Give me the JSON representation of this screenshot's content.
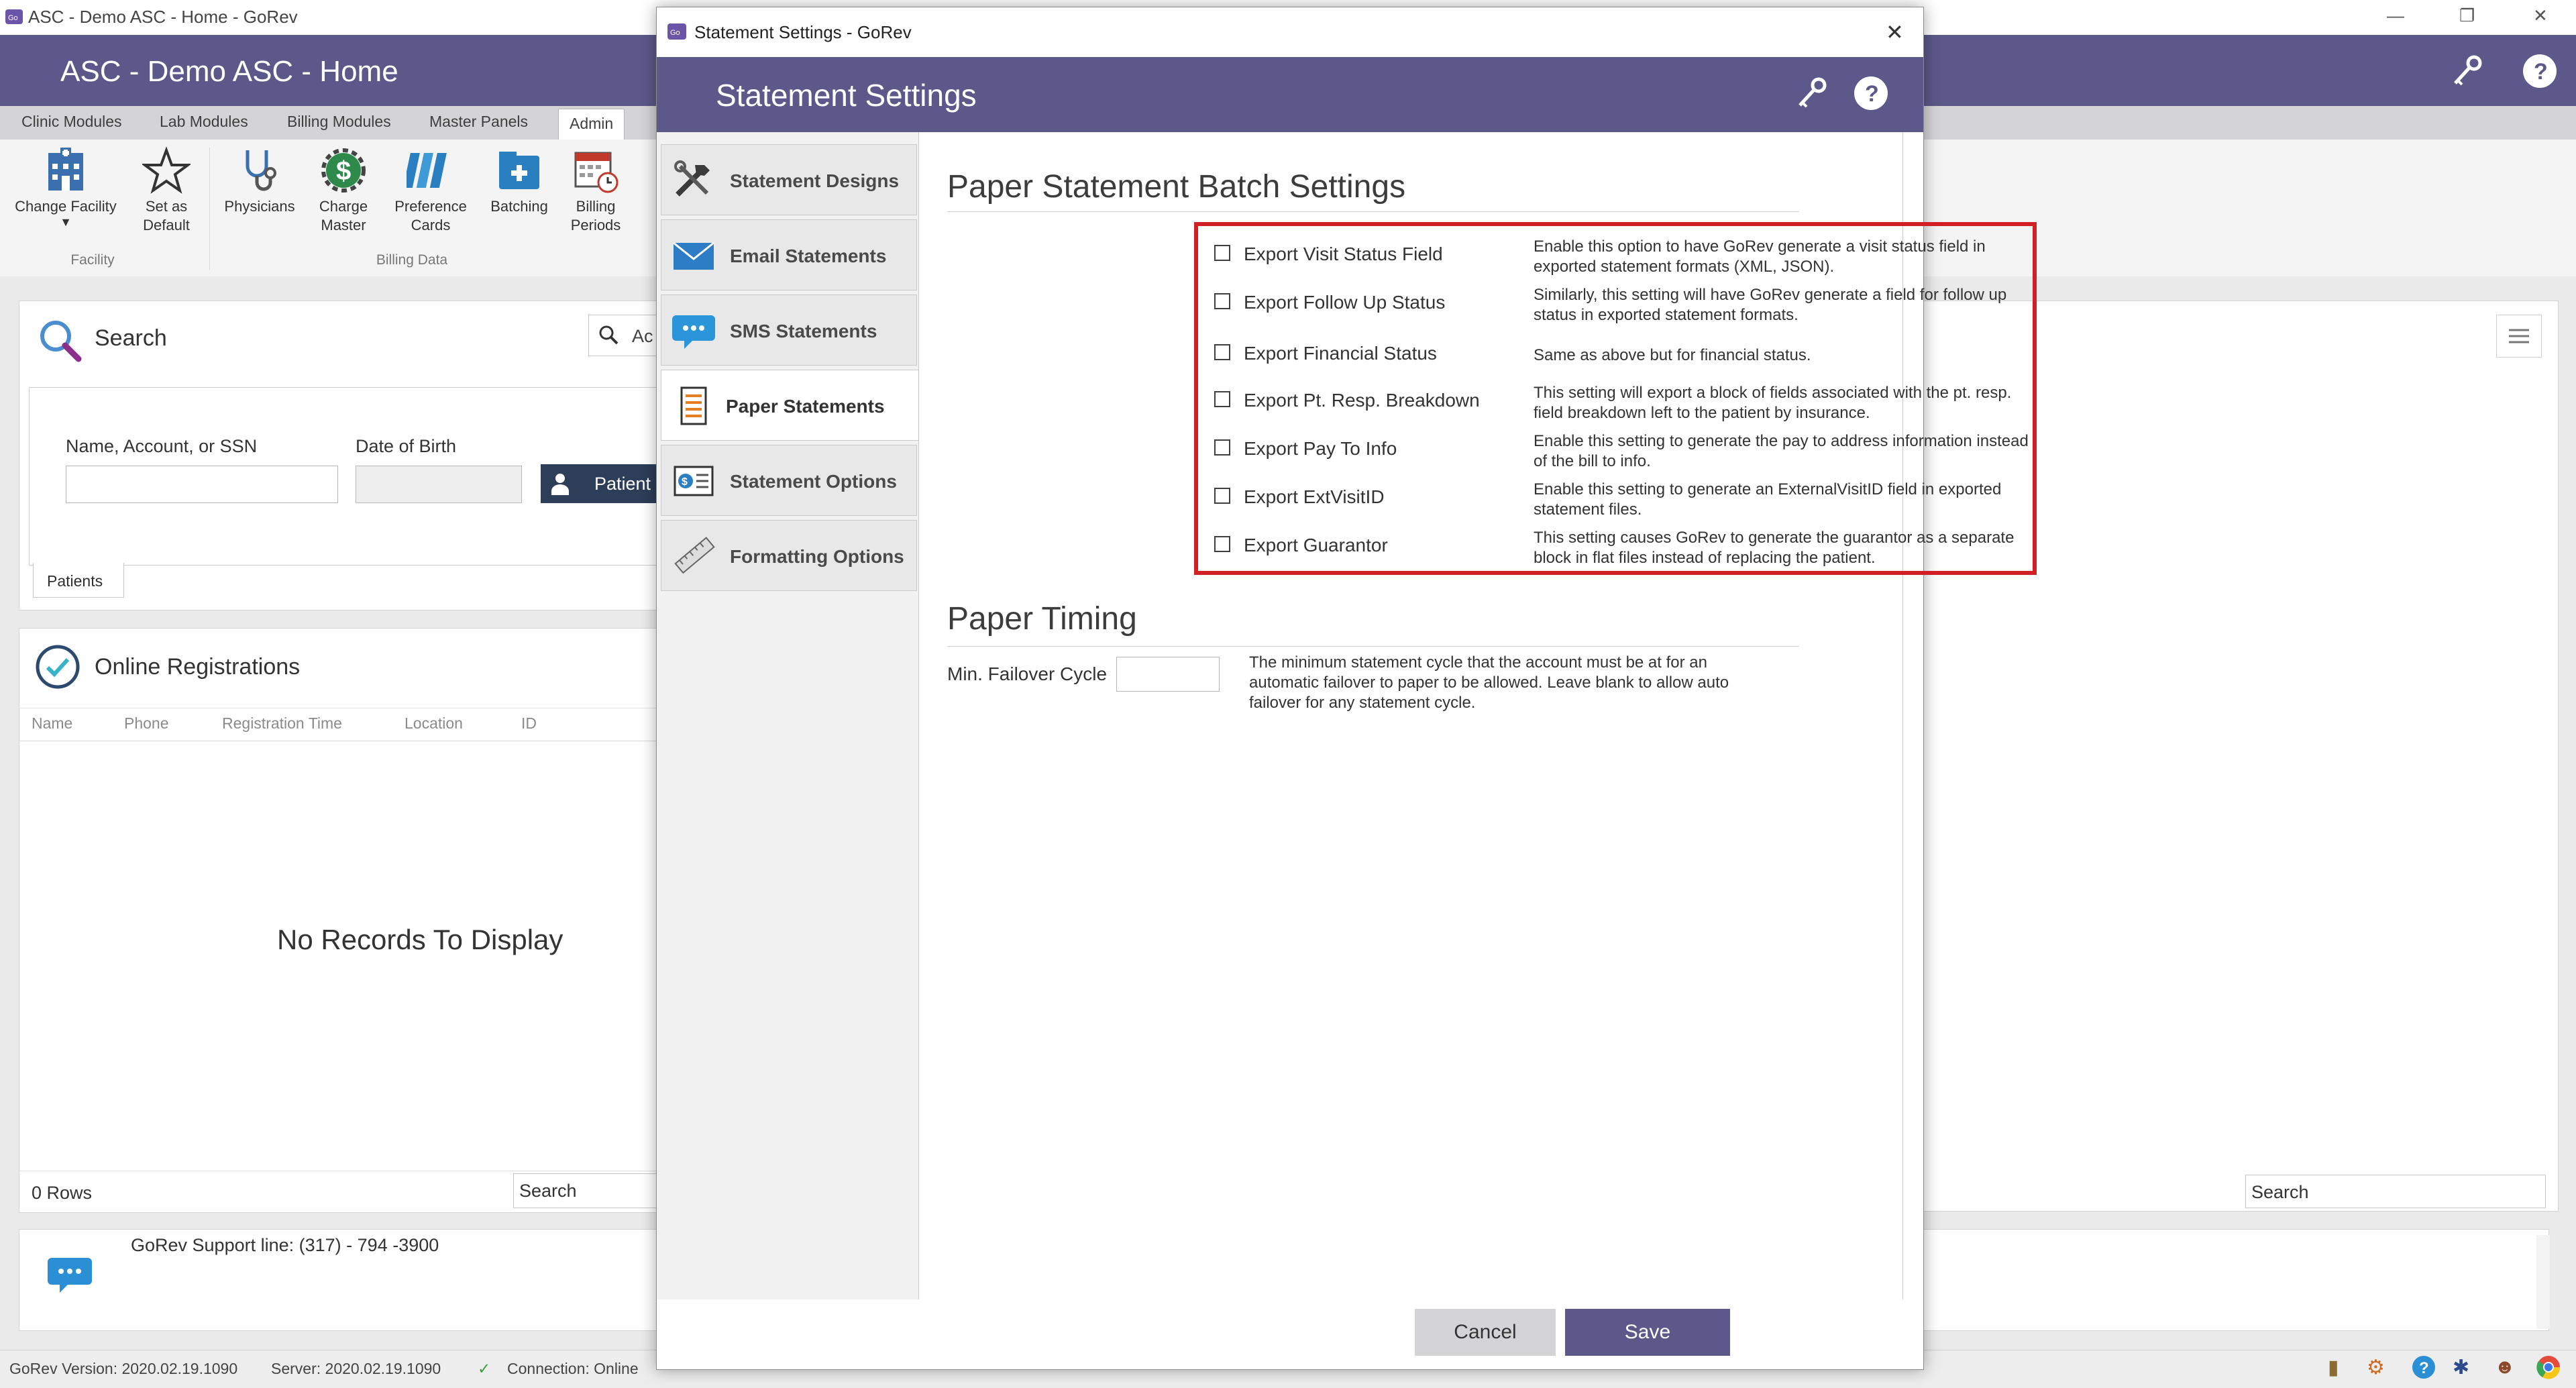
{
  "app": {
    "window_title": "ASC - Demo ASC - Home - GoRev",
    "header_title": "ASC - Demo ASC - Home"
  },
  "ribbon_tabs": [
    "Clinic Modules",
    "Lab Modules",
    "Billing Modules",
    "Master Panels",
    "Admin"
  ],
  "ribbon": {
    "buttons": [
      {
        "label": "Change Facility"
      },
      {
        "label": "Set as Default"
      },
      {
        "label": "Physicians"
      },
      {
        "label": "Charge Master"
      },
      {
        "label": "Preference Cards"
      },
      {
        "label": "Batching"
      },
      {
        "label": "Billing Periods"
      }
    ],
    "groups": {
      "facility": "Facility",
      "billing_data": "Billing Data"
    }
  },
  "search_panel": {
    "title": "Search",
    "search_stub": "Ac",
    "name_label": "Name, Account, or SSN",
    "dob_label": "Date of Birth",
    "patient_button": "Patient",
    "patients_tab": "Patients"
  },
  "online_panel": {
    "title": "Online Registrations",
    "columns": [
      "Name",
      "Phone",
      "Registration Time",
      "Location",
      "ID"
    ],
    "empty_text": "No Records To Display",
    "rows_text": "0 Rows",
    "search_placeholder": "Search"
  },
  "right_panel": {
    "search_placeholder": "Search"
  },
  "support": {
    "text": "GoRev Support line: (317) - 794 -3900"
  },
  "statusbar": {
    "version": "GoRev Version: 2020.02.19.1090",
    "server": "Server: 2020.02.19.1090",
    "connection": "Connection: Online"
  },
  "modal": {
    "window_title": "Statement Settings - GoRev",
    "header_title": "Statement Settings",
    "nav": [
      {
        "label": "Statement Designs",
        "icon": "tools-icon"
      },
      {
        "label": "Email Statements",
        "icon": "envelope-icon"
      },
      {
        "label": "SMS Statements",
        "icon": "chat-bubble-icon"
      },
      {
        "label": "Paper Statements",
        "icon": "document-icon"
      },
      {
        "label": "Statement Options",
        "icon": "statement-options-icon"
      },
      {
        "label": "Formatting Options",
        "icon": "ruler-icon"
      }
    ],
    "batch_title": "Paper Statement Batch Settings",
    "options": [
      {
        "label": "Export Visit Status Field",
        "checked": false,
        "desc": "Enable this option to have GoRev generate a visit status field in exported statement formats (XML, JSON)."
      },
      {
        "label": "Export Follow Up Status",
        "checked": false,
        "desc": "Similarly, this setting will have GoRev generate a field for follow up status in exported statement formats."
      },
      {
        "label": "Export Financial Status",
        "checked": false,
        "desc": "Same as above but for financial status."
      },
      {
        "label": "Export Pt. Resp. Breakdown",
        "checked": false,
        "desc": "This setting will export a block of fields associated with the pt. resp. field breakdown left to the patient by insurance."
      },
      {
        "label": "Export Pay To Info",
        "checked": false,
        "desc": "Enable this setting to generate the pay to address information instead of the bill to info."
      },
      {
        "label": "Export ExtVisitID",
        "checked": false,
        "desc": "Enable this setting to generate an ExternalVisitID field in exported statement files."
      },
      {
        "label": "Export Guarantor",
        "checked": false,
        "desc": "This setting causes GoRev to generate the guarantor as a separate block in flat files instead of replacing the patient."
      }
    ],
    "timing_title": "Paper Timing",
    "failover_label": "Min. Failover Cycle",
    "failover_value": "",
    "failover_desc": "The minimum statement cycle that the account must be at for an automatic failover to paper to be allowed. Leave blank to allow auto failover for any statement cycle.",
    "cancel": "Cancel",
    "save": "Save"
  },
  "colors": {
    "header_purple": "#5c5889",
    "highlight_red": "#d11f26",
    "save_button": "#5c5889",
    "cancel_button": "#d4d4d6"
  }
}
